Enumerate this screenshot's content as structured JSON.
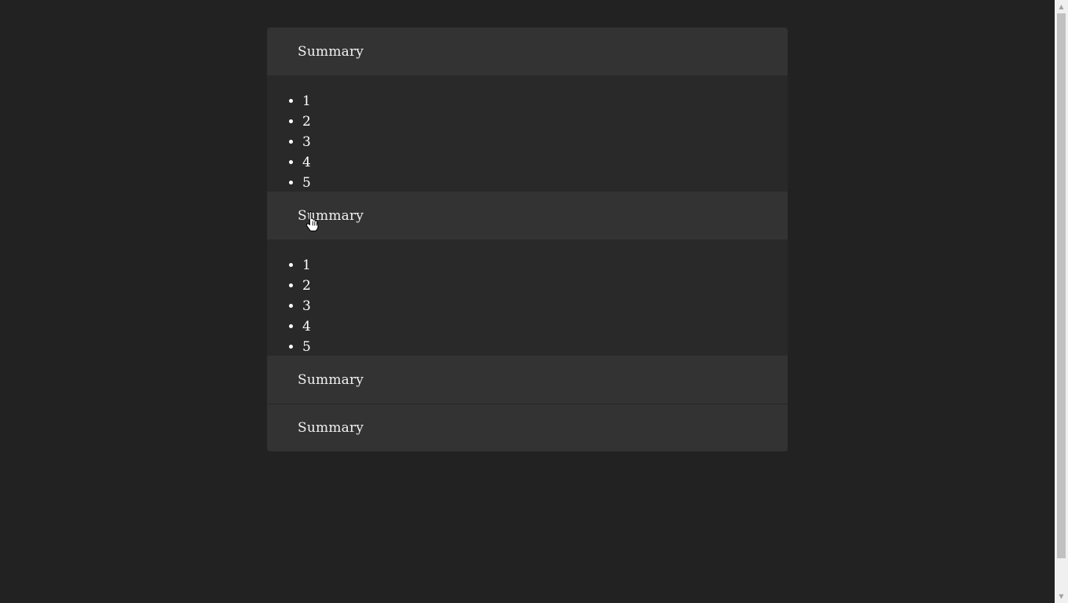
{
  "accordion": {
    "items": [
      {
        "summary": "Summary",
        "expanded": true,
        "list": [
          "1",
          "2",
          "3",
          "4",
          "5"
        ]
      },
      {
        "summary": "Summary",
        "expanded": true,
        "list": [
          "1",
          "2",
          "3",
          "4",
          "5"
        ]
      },
      {
        "summary": "Summary",
        "expanded": false
      },
      {
        "summary": "Summary",
        "expanded": false
      }
    ]
  },
  "colors": {
    "page_background": "#222222",
    "summary_background": "#333333",
    "details_background": "#292929",
    "text": "#ffffff"
  },
  "icons": {
    "scroll_up": "triangle-up-icon",
    "scroll_down": "triangle-down-icon",
    "cursor": "hand-pointer-icon"
  }
}
